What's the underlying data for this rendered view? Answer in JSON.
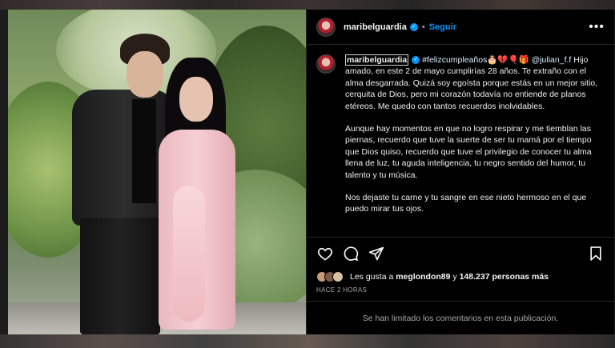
{
  "header": {
    "username": "maribelguardia",
    "follow_label": "Seguir",
    "more_label": "•••"
  },
  "caption": {
    "username": "maribelguardia",
    "hashtag": "#felizcumpleaños",
    "emojis": "🎂💔🎈🎁",
    "mention": "@julian_f.f",
    "p1": " Hijo amado, en este 2 de mayo cumplirías 28 años. Te extraño con el alma desgarrada. Quizá soy egoísta porque estás en un mejor sitio, cerquita de Dios, pero mi corazón todavía no entiende de planos etéreos. Me quedo con tantos recuerdos inolvidables.",
    "p2": "Aunque hay momentos en que no logro respirar y me tiemblan las piernas, recuerdo que tuve la suerte de ser tu mamá por el tiempo que Dios quiso, recuerdo que tuve el privilegio de conocer tu alma llena de luz, tu aguda inteligencia, tu negro sentido del humor, tu talento y tu música.",
    "p3": "Nos dejaste tu carne y tu sangre en ese nieto hermoso en el que puedo mirar tus ojos."
  },
  "actions": {
    "like_icon": "heart-icon",
    "comment_icon": "comment-icon",
    "share_icon": "share-icon",
    "save_icon": "bookmark-icon"
  },
  "likes": {
    "prefix": "Les gusta a ",
    "user": "meglondon89",
    "middle": " y ",
    "count": "148.237 personas más"
  },
  "timestamp": "HACE 2 HORAS",
  "comments_limited": "Se han limitado los comentarios en esta publicación.",
  "colors": {
    "accent": "#0095f6",
    "background": "#000000",
    "muted": "#a8a8a8"
  }
}
